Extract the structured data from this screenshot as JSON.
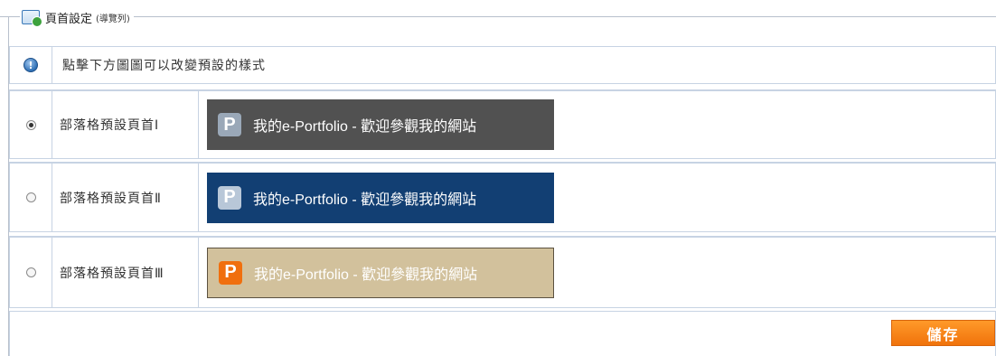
{
  "legend": {
    "title": "頁首設定",
    "subtitle": "(導覽列)",
    "icon": "page-header-settings-icon"
  },
  "info": {
    "text": "點擊下方圖圖可以改變預設的樣式",
    "icon": "info-icon"
  },
  "options": [
    {
      "label": "部落格預設頁首Ⅰ",
      "selected": true,
      "banner_text": "我的e-Portfolio - 歡迎參觀我的網站",
      "logo_letter": "P",
      "banner_bg": "#515151",
      "logo_bg": "#9aa8b8"
    },
    {
      "label": "部落格預設頁首Ⅱ",
      "selected": false,
      "banner_text": "我的e-Portfolio - 歡迎參觀我的網站",
      "logo_letter": "P",
      "banner_bg": "#123f73",
      "logo_bg": "#b8c7d8"
    },
    {
      "label": "部落格預設頁首Ⅲ",
      "selected": false,
      "banner_text": "我的e-Portfolio - 歡迎參觀我的網站",
      "logo_letter": "P",
      "banner_bg": "#d2c19c",
      "logo_bg": "#f06f0e"
    }
  ],
  "save_button": {
    "label": "儲存",
    "color": "#f0720b"
  }
}
